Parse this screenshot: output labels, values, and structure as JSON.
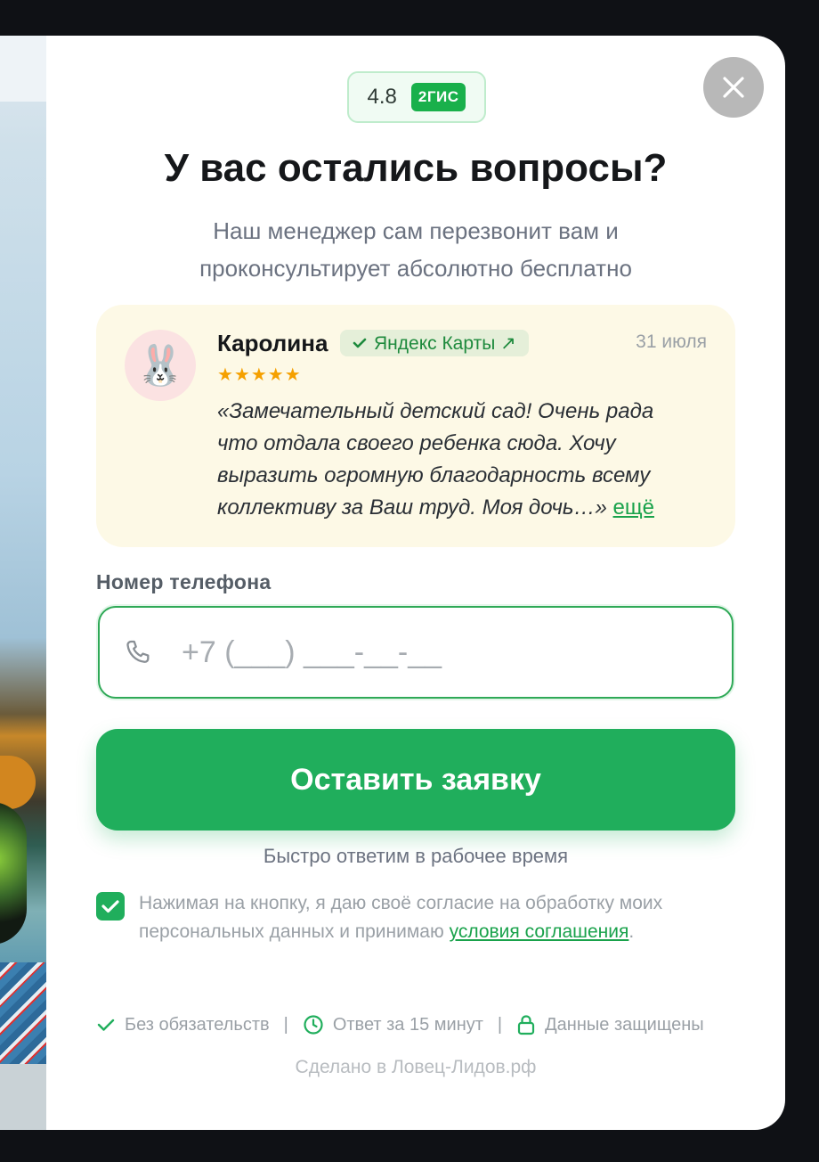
{
  "rating": {
    "value": "4.8",
    "badge": "2ГИС"
  },
  "title": "У вас остались вопросы?",
  "subtitle": "Наш менеджер сам перезвонит вам и проконсультирует абсолютно бесплатно",
  "review": {
    "avatar_emoji": "🐰",
    "name": "Каролина",
    "source": "Яндекс Карты ↗",
    "date": "31 июля",
    "stars": "★★★★★",
    "text": "«Замечательный детский сад! Очень рада что отдала своего ребенка сюда. Хочу выразить огромную благодарность всему коллективу за Ваш труд. Моя дочь…»",
    "more_link": "ещё"
  },
  "phone": {
    "label": "Номер телефона",
    "placeholder": "+7 (___) ___-__-__"
  },
  "submit_label": "Оставить заявку",
  "hint": "Быстро ответим в рабочее время",
  "consent": {
    "checked": true,
    "text": "Нажимая на кнопку, я даю своё согласие на обработку моих персональных данных и принимаю ",
    "link": "условия соглашения",
    "after": "."
  },
  "features": [
    "Без обязательств",
    "Ответ за 15 минут",
    "Данные защищены"
  ],
  "credit": "Сделано в Ловец-Лидов.рф",
  "colors": {
    "accent": "#20ae5c",
    "review_bg": "#fdf9e6",
    "star": "#f5a000"
  }
}
